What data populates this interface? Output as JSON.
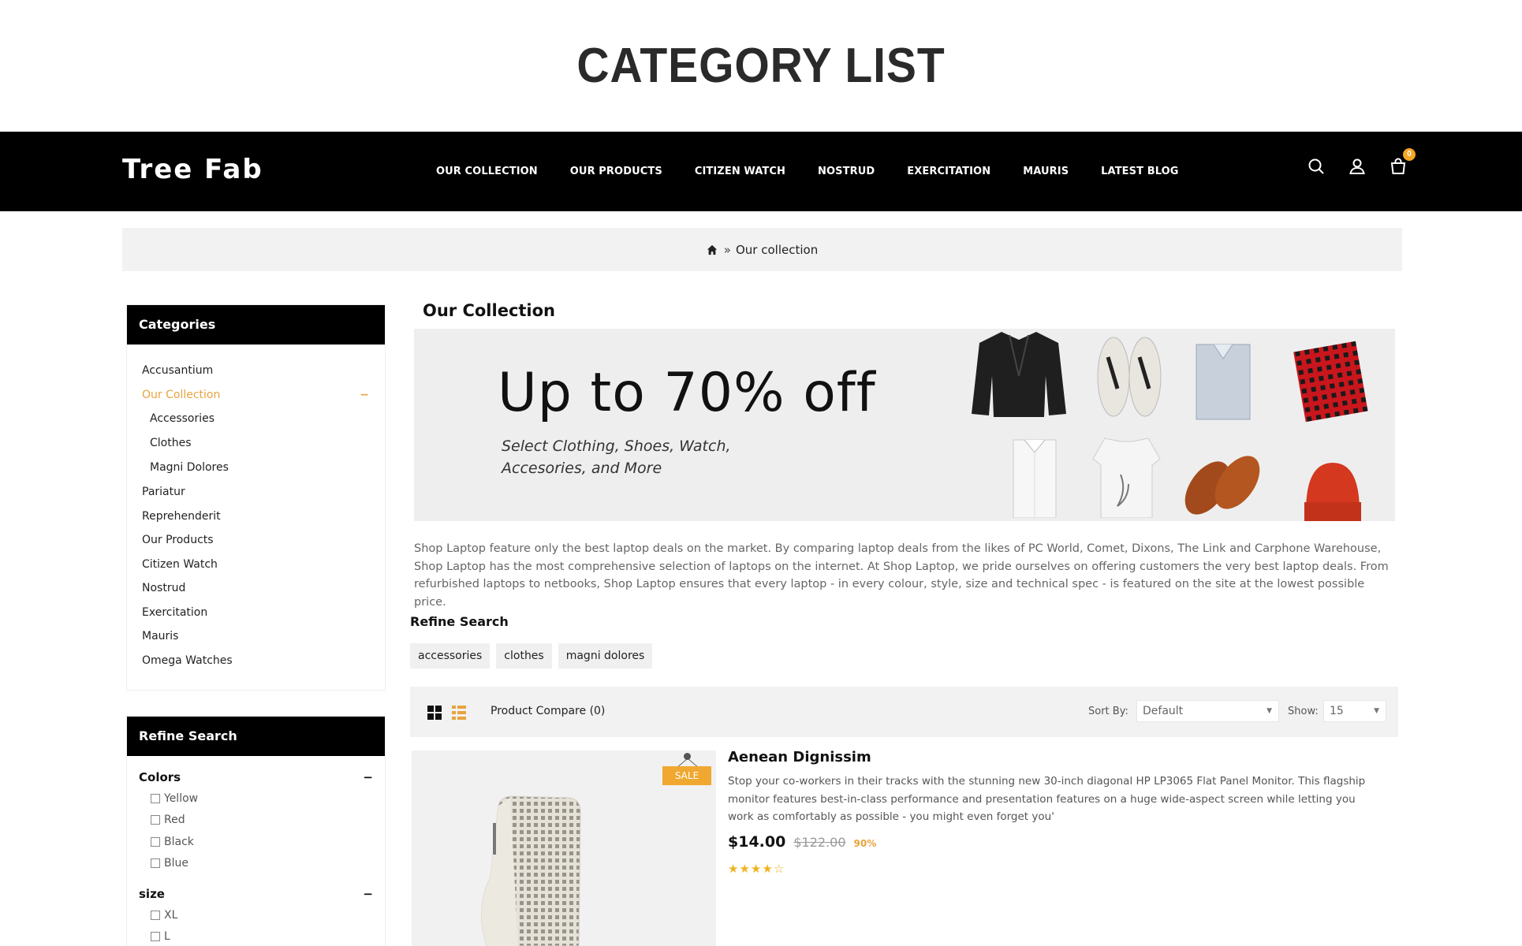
{
  "page": {
    "title": "CATEGORY LIST"
  },
  "header": {
    "logo": "Tree Fab",
    "menu": [
      "OUR COLLECTION",
      "OUR PRODUCTS",
      "CITIZEN WATCH",
      "NOSTRUD",
      "EXERCITATION",
      "MAURIS",
      "LATEST BLOG"
    ],
    "cart_count": "0",
    "icons": [
      "search-icon",
      "user-icon",
      "cart-icon"
    ]
  },
  "breadcrumb": {
    "separator": "»",
    "current": "Our collection"
  },
  "sidebar": {
    "categories_title": "Categories",
    "categories": [
      {
        "label": "Accusantium"
      },
      {
        "label": "Our Collection",
        "active": true,
        "toggle": "−",
        "children": [
          "Accessories",
          "Clothes",
          "Magni Dolores"
        ]
      },
      {
        "label": "Pariatur"
      },
      {
        "label": "Reprehenderit"
      },
      {
        "label": "Our Products"
      },
      {
        "label": "Citizen Watch"
      },
      {
        "label": "Nostrud"
      },
      {
        "label": "Exercitation"
      },
      {
        "label": "Mauris"
      },
      {
        "label": "Omega Watches"
      }
    ],
    "refine_title": "Refine Search",
    "filters": [
      {
        "name": "Colors",
        "toggle": "−",
        "options": [
          "Yellow",
          "Red",
          "Black",
          "Blue"
        ]
      },
      {
        "name": "size",
        "toggle": "−",
        "options": [
          "XL",
          "L"
        ]
      }
    ]
  },
  "main": {
    "title": "Our Collection",
    "banner": {
      "headline": "Up to 70% off",
      "subtitle_line1": "Select Clothing, Shoes, Watch,",
      "subtitle_line2": "Accesories, and More"
    },
    "description": "Shop Laptop feature only the best laptop deals on the market. By comparing laptop deals from the likes of PC World, Comet, Dixons, The Link and Carphone Warehouse, Shop Laptop has the most comprehensive selection of laptops on the internet. At Shop Laptop, we pride ourselves on offering customers the very best laptop deals. From refurbished laptops to netbooks, Shop Laptop ensures that every laptop - in every colour, style, size and technical spec - is featured on the site at the lowest possible price.",
    "refine_title": "Refine Search",
    "tags": [
      "accessories",
      "clothes",
      "magni dolores"
    ],
    "toolbar": {
      "compare": "Product Compare (0)",
      "sort_label": "Sort By:",
      "sort_value": "Default",
      "show_label": "Show:",
      "show_value": "15"
    },
    "product": {
      "badge": "SALE",
      "name": "Aenean Dignissim",
      "description": "Stop your co-workers in their tracks with the stunning new 30-inch diagonal HP LP3065 Flat Panel Monitor. This flagship monitor features best-in-class performance and presentation features on a huge wide-aspect screen while letting you work as comfortably as possible - you might even forget you'",
      "price_new": "$14.00",
      "price_old": "$122.00",
      "discount": "90%",
      "rating": 4,
      "rating_max": 5
    }
  },
  "colors": {
    "accent": "#e8a33d",
    "header_bg": "#000000",
    "badge": "#f0a830"
  }
}
